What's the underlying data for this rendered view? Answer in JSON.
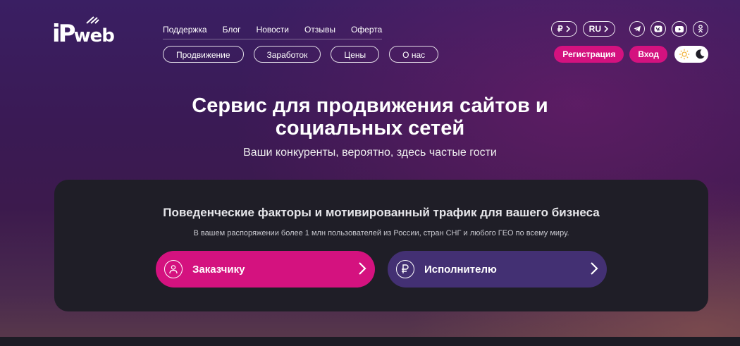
{
  "brand": {
    "logo_text_a": "iP",
    "logo_text_b": "web"
  },
  "top_links": [
    "Поддержка",
    "Блог",
    "Новости",
    "Отзывы",
    "Оферта"
  ],
  "pill_links": [
    "Продвижение",
    "Заработок",
    "Цены",
    "О нас"
  ],
  "currency": {
    "symbol": "₽"
  },
  "language": {
    "code": "RU"
  },
  "social": [
    "telegram-icon",
    "vk-icon",
    "youtube-icon",
    "odnoklassniki-icon"
  ],
  "auth": {
    "register": "Регистрация",
    "login": "Вход"
  },
  "hero": {
    "title_line1": "Сервис для продвижения сайтов и",
    "title_line2": "социальных сетей",
    "subtitle": "Ваши конкуренты, вероятно, здесь частые гости"
  },
  "card": {
    "title": "Поведенческие факторы и мотивированный трафик для вашего бизнеса",
    "subtitle": "В вашем распоряжении более 1 млн пользователей из России, стран СНГ и любого ГЕО по всему миру.",
    "customer_label": "Заказчику",
    "performer_label": "Исполнителю"
  },
  "colors": {
    "accent": "#d4127f",
    "performer": "#433073",
    "card": "#1f1e27"
  }
}
